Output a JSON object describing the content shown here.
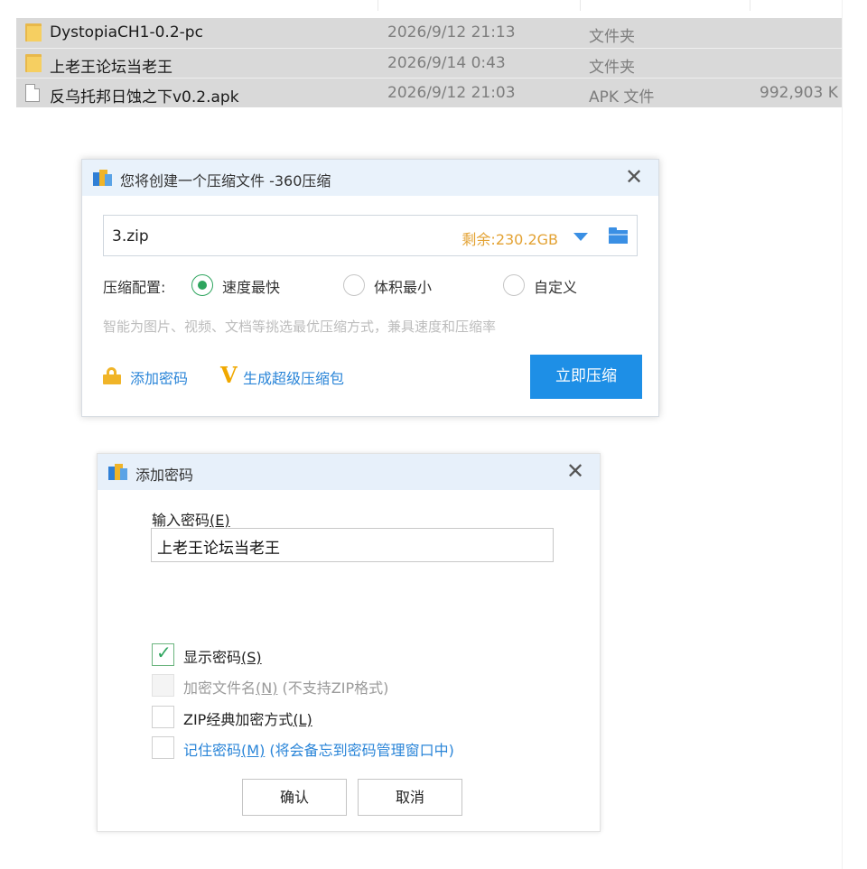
{
  "explorer": {
    "files": [
      {
        "icon": "folder-icon",
        "name": "DystopiaCH1-0.2-pc",
        "date": "2026/9/12 21:13",
        "type": "文件夹",
        "size": ""
      },
      {
        "icon": "folder-icon",
        "name": "上老王论坛当老王",
        "date": "2026/9/14 0:43",
        "type": "文件夹",
        "size": ""
      },
      {
        "icon": "file-icon",
        "name": "反乌托邦日蚀之下v0.2.apk",
        "date": "2026/9/12 21:03",
        "type": "APK 文件",
        "size": "992,903 K"
      }
    ]
  },
  "compress_dialog": {
    "title": "您将创建一个压缩文件 -360压缩",
    "close": "✕",
    "filename": "3.zip",
    "free_space": "剩余:230.2GB",
    "config_label": "压缩配置:",
    "options": [
      {
        "label": "速度最快",
        "selected": true
      },
      {
        "label": "体积最小",
        "selected": false
      },
      {
        "label": "自定义",
        "selected": false
      }
    ],
    "hint": "智能为图片、视频、文档等挑选最优压缩方式，兼具速度和压缩率",
    "add_password": "添加密码",
    "super_package": "生成超级压缩包",
    "compress_now": "立即压缩"
  },
  "password_dialog": {
    "title": "添加密码",
    "close": "✕",
    "input_label": "输入密码",
    "input_label_key": "(E)",
    "password_value": "上老王论坛当老王",
    "checkboxes": [
      {
        "label": "显示密码",
        "key": "(S)",
        "suffix": "",
        "checked": true,
        "disabled": false
      },
      {
        "label": "加密文件名",
        "key": "(N)",
        "suffix": " (不支持ZIP格式)",
        "checked": false,
        "disabled": true
      },
      {
        "label": "ZIP经典加密方式",
        "key": "(L)",
        "suffix": "",
        "checked": false,
        "disabled": false
      },
      {
        "label": "记住密码",
        "key": "(M)",
        "suffix": " (将会备忘到密码管理窗口中)",
        "checked": false,
        "disabled": false
      }
    ],
    "ok": "确认",
    "cancel": "取消"
  },
  "colors": {
    "accent_blue": "#1e8fe6",
    "link_blue": "#2a85d8",
    "radio_green": "#2ea55e",
    "space_orange": "#e3a233",
    "selection_gray": "#d9d9d9"
  }
}
